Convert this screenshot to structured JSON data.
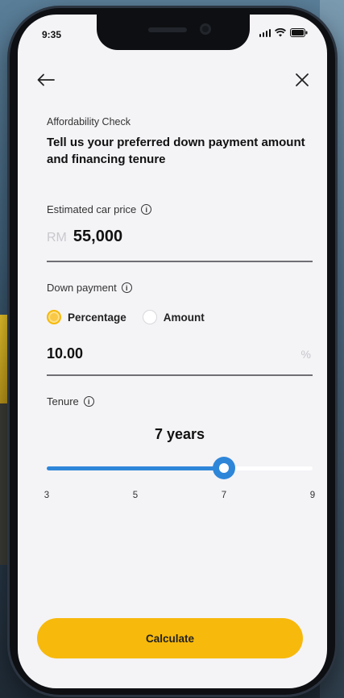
{
  "status_bar": {
    "time": "9:35"
  },
  "header": {
    "eyebrow": "Affordability Check",
    "title": "Tell us your preferred down payment amount and financing tenure"
  },
  "car_price": {
    "label": "Estimated car price",
    "currency": "RM",
    "value": "55,000"
  },
  "down_payment": {
    "label": "Down payment",
    "options": [
      {
        "label": "Percentage",
        "selected": true
      },
      {
        "label": "Amount",
        "selected": false
      }
    ],
    "value": "10.00",
    "unit": "%"
  },
  "tenure": {
    "label": "Tenure",
    "display": "7 years",
    "value": 7,
    "min": 3,
    "max": 9,
    "ticks": [
      "3",
      "5",
      "7",
      "9"
    ]
  },
  "calculate_button": {
    "label": "Calculate"
  },
  "colors": {
    "accent": "#f7b90c",
    "slider": "#2e86d9",
    "background": "#f4f3f6"
  }
}
